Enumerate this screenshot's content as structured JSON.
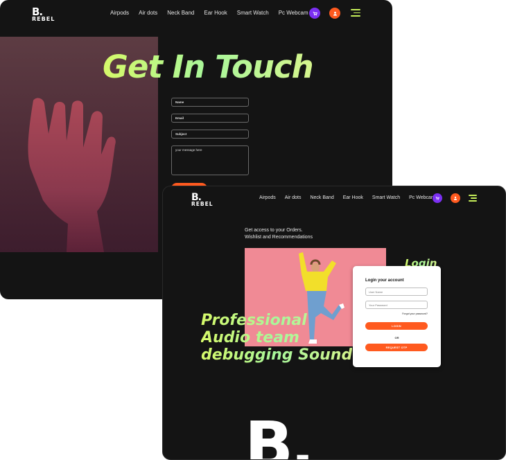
{
  "brand": {
    "mark": "B.",
    "name": "REBEL"
  },
  "contact_page": {
    "nav": [
      "Airpods",
      "Air dots",
      "Neck Band",
      "Ear Hook",
      "Smart Watch",
      "Pc Webcam"
    ],
    "hero_title": "Get In Touch",
    "form": {
      "name_placeholder": "Name",
      "email_placeholder": "Email",
      "subject_placeholder": "Subject",
      "message_placeholder": "your message here"
    }
  },
  "login_page": {
    "nav": [
      "Airpods",
      "Air dots",
      "Neck Band",
      "Ear Hook",
      "Smart Watch",
      "Pc Webcam"
    ],
    "tagline": [
      "Get access to your Orders.",
      "Wishlist and Recommendations"
    ],
    "side_title": "Login",
    "promo": [
      "Professional",
      "Audio team",
      "debugging Sound"
    ],
    "card": {
      "title": "Login your account",
      "username_placeholder": "User Name",
      "password_placeholder": "Your Password",
      "forgot": "Forgot your password?",
      "login_button": "LOGIN",
      "or": "OR",
      "otp_button": "REQUEST OTP"
    },
    "footer_mark": "B."
  },
  "colors": {
    "accent_orange": "#ff5a1f",
    "accent_purple": "#7b2ff2",
    "accent_lime": "#c7f05a",
    "background": "#141414"
  },
  "icons": [
    "cart-icon",
    "user-icon",
    "menu-icon"
  ]
}
